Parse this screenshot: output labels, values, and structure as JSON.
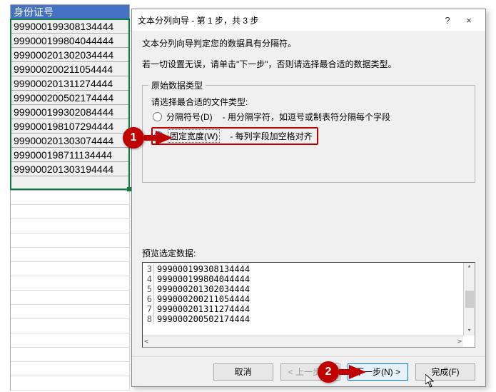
{
  "sheet": {
    "header": "身份证号",
    "rows": [
      "999000199308134444",
      "999000199804044444",
      "999000201302034444",
      "999000200211054444",
      "999000201311274444",
      "999000200502174444",
      "999000199302084444",
      "999000198107294444",
      "999000201303074444",
      "999000198711134444",
      "999000201303194444"
    ]
  },
  "dialog": {
    "title": "文本分列向导 - 第 1 步，共 3 步",
    "help": "?",
    "close": "×",
    "intro1": "文本分列向导判定您的数据具有分隔符。",
    "intro2": "若一切设置无误，请单击\"下一步\"，否则请选择最合适的数据类型。",
    "group_title": "原始数据类型",
    "group_hint": "请选择最合适的文件类型:",
    "opt1_label": "分隔符号(D)",
    "opt1_desc": "- 用分隔字符，如逗号或制表符分隔每个字段",
    "opt2_label": "固定宽度(W)",
    "opt2_desc": "- 每列字段加空格对齐",
    "preview_label": "预览选定数据:",
    "preview": [
      {
        "n": "3",
        "t": "999000199308134444"
      },
      {
        "n": "4",
        "t": "999000199804044444"
      },
      {
        "n": "5",
        "t": "999000201302034444"
      },
      {
        "n": "6",
        "t": "999000200211054444"
      },
      {
        "n": "7",
        "t": "999000201311274444"
      },
      {
        "n": "8",
        "t": "999000200502174444"
      }
    ],
    "btn_cancel": "取消",
    "btn_back": "< 上一步(B)",
    "btn_next": "下一步(N) >",
    "btn_finish": "完成(F)"
  },
  "callouts": {
    "c1": "1",
    "c2": "2"
  }
}
